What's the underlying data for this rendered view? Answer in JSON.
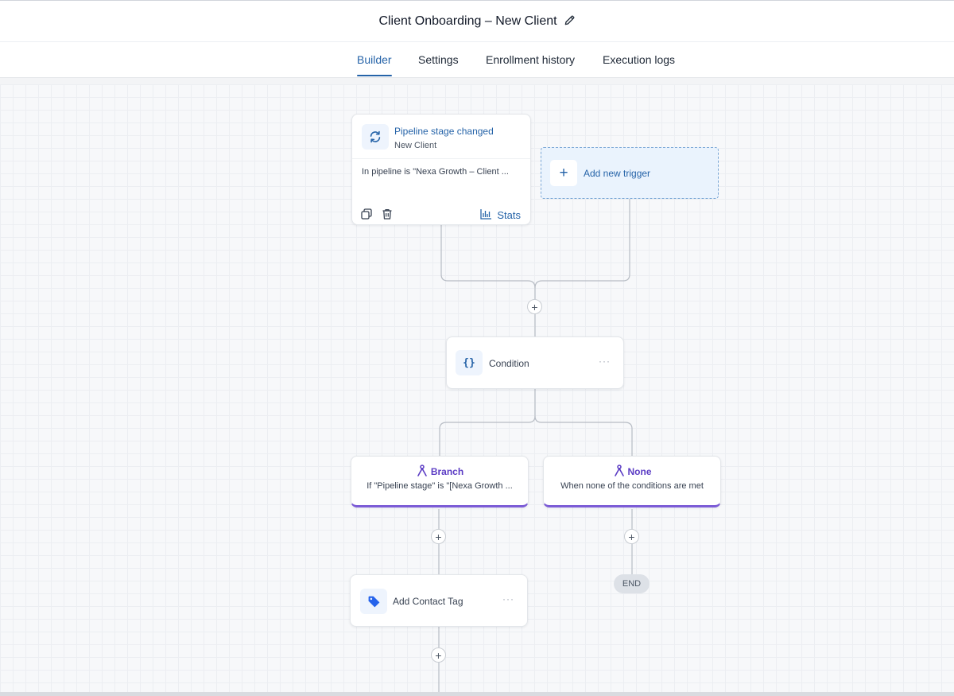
{
  "header": {
    "title": "Client Onboarding – New Client",
    "edit_icon": "pencil-icon"
  },
  "tabs": [
    {
      "label": "Builder",
      "active": true
    },
    {
      "label": "Settings",
      "active": false
    },
    {
      "label": "Enrollment history",
      "active": false
    },
    {
      "label": "Execution logs",
      "active": false
    }
  ],
  "trigger": {
    "icon": "refresh-icon",
    "title": "Pipeline stage changed",
    "subtitle": "New Client",
    "filter": "In pipeline is \"Nexa Growth – Client ...",
    "copy_icon": "copy-icon",
    "delete_icon": "trash-icon",
    "stats_icon": "bar-chart-icon",
    "stats_label": "Stats"
  },
  "add_trigger": {
    "label": "Add new trigger"
  },
  "condition": {
    "icon": "braces-icon",
    "icon_text": "{}",
    "label": "Condition",
    "menu": "···"
  },
  "branches": [
    {
      "icon": "branch-icon",
      "title": "Branch",
      "description": "If \"Pipeline stage\" is \"[Nexa Growth ..."
    },
    {
      "icon": "branch-icon",
      "title": "None",
      "description": "When none of the conditions are met"
    }
  ],
  "action": {
    "icon": "tag-icon",
    "label": "Add Contact Tag",
    "menu": "···"
  },
  "end_label": "END",
  "colors": {
    "accent": "#2563a8",
    "branch": "#7c5cd6",
    "connector": "#b7bcc4"
  }
}
